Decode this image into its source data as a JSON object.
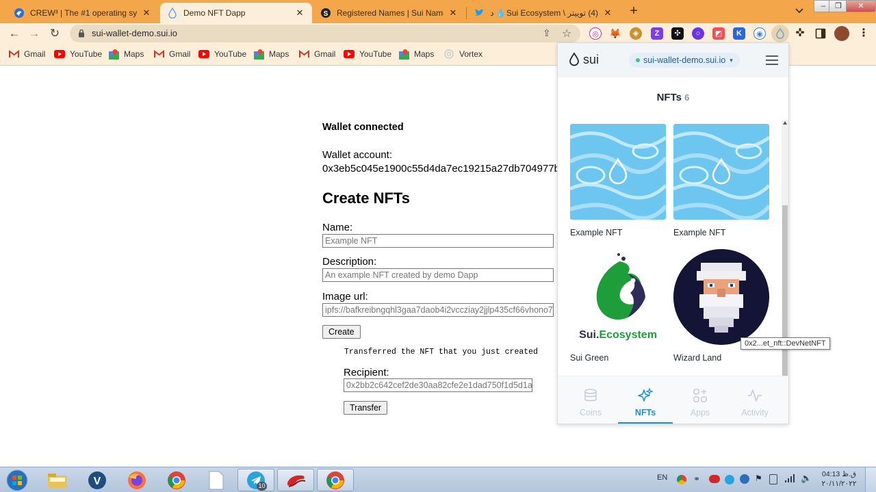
{
  "browser": {
    "tabs": [
      {
        "title": "CREW³ | The #1 operating system",
        "icon": "crew3-icon",
        "active": false
      },
      {
        "title": "Demo NFT Dapp",
        "icon": "sui-drop-icon",
        "active": true
      },
      {
        "title": "Registered Names | Sui Name Se",
        "icon": "sui-ns-icon",
        "active": false
      },
      {
        "title": "(4) توییتر \\ Sui Ecosystem💧 در توییت",
        "icon": "twitter-icon",
        "active": false
      }
    ],
    "url": "sui-wallet-demo.sui.io",
    "bookmarks": [
      {
        "label": "Gmail",
        "icon": "gmail-icon"
      },
      {
        "label": "YouTube",
        "icon": "youtube-icon"
      },
      {
        "label": "Maps",
        "icon": "maps-icon"
      },
      {
        "label": "Gmail",
        "icon": "gmail-icon"
      },
      {
        "label": "YouTube",
        "icon": "youtube-icon"
      },
      {
        "label": "Maps",
        "icon": "maps-icon"
      },
      {
        "label": "Gmail",
        "icon": "gmail-icon"
      },
      {
        "label": "YouTube",
        "icon": "youtube-icon"
      },
      {
        "label": "Maps",
        "icon": "maps-icon"
      },
      {
        "label": "Vortex",
        "icon": "vortex-icon"
      }
    ]
  },
  "page": {
    "status": "Wallet connected",
    "account_label": "Wallet account:",
    "account_address": "0x3eb5c045e1900c55d4da7ec19215a27db704977b",
    "heading": "Create NFTs",
    "name_label": "Name:",
    "name_placeholder": "Example NFT",
    "description_label": "Description:",
    "description_placeholder": "An example NFT created by demo Dapp",
    "image_url_label": "Image url:",
    "image_url_value": "ipfs://bafkreibngqhl3gaa7daob4i2vccziay2jjlp435cf66vhono7",
    "create_button": "Create",
    "transfer_message": "Transferred the NFT that you just created",
    "recipient_label": "Recipient:",
    "recipient_value": "0x2bb2c642cef2de30aa82cfe2e1dad750f1d5d1a",
    "transfer_button": "Transfer"
  },
  "wallet": {
    "logo_text": "sui",
    "site": "sui-wallet-demo.sui.io",
    "section_title": "NFTs",
    "nft_count": "6",
    "nfts": [
      {
        "name": "Example NFT",
        "image": "example-nft-image"
      },
      {
        "name": "Example NFT",
        "image": "example-nft-image"
      },
      {
        "name": "Sui Green",
        "image": "sui-ecosystem-logo"
      },
      {
        "name": "Wizard Land",
        "image": "wizard-pixel-art"
      }
    ],
    "sui_green_logo_text": "Sui.Ecosystem",
    "tooltip": "0x2...et_nft::DevNetNFT",
    "nav": [
      {
        "label": "Coins",
        "icon": "coins-icon",
        "active": false
      },
      {
        "label": "NFTs",
        "icon": "sparkles-icon",
        "active": true
      },
      {
        "label": "Apps",
        "icon": "apps-grid-icon",
        "active": false
      },
      {
        "label": "Activity",
        "icon": "activity-icon",
        "active": false
      }
    ],
    "accent_color": "#1a8fd8"
  },
  "taskbar": {
    "language": "EN",
    "time": "04:13 ق.ظ",
    "date": "۲۰/۱۱/۲۰۲۲",
    "telegram_badge": "10"
  }
}
